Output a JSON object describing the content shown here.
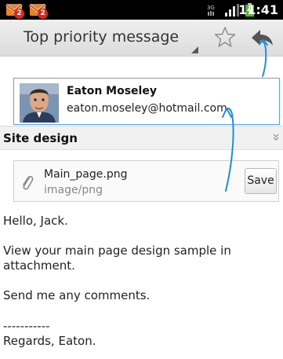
{
  "status_bar": {
    "notifications": [
      {
        "icon": "gmail-icon",
        "count": "2"
      },
      {
        "icon": "gmail-icon",
        "count": "2"
      }
    ],
    "icons": [
      "3g-icon",
      "signal-icon",
      "battery-charging-icon"
    ],
    "time": "11:41"
  },
  "action_bar": {
    "subject": "Top priority message",
    "star_icon": "star-outline-icon",
    "reply_icon": "reply-icon"
  },
  "sender": {
    "name": "Eaton Moseley",
    "email": "eaton.moseley@hotmail.com"
  },
  "subject_row": {
    "title": "Site design"
  },
  "attachment": {
    "filename": "Main_page.png",
    "mimetype": "image/png",
    "save_label": "Save"
  },
  "body": {
    "greeting": "Hello, Jack.",
    "line1": "View your main page design sample in",
    "line2": "attachment.",
    "line3": "Send me any comments.",
    "separator": "-----------",
    "signature": "Regards, Eaton."
  },
  "colors": {
    "accent": "#1f8fd6",
    "badge": "#d82a1a",
    "sender_border": "#5aa7e0"
  }
}
